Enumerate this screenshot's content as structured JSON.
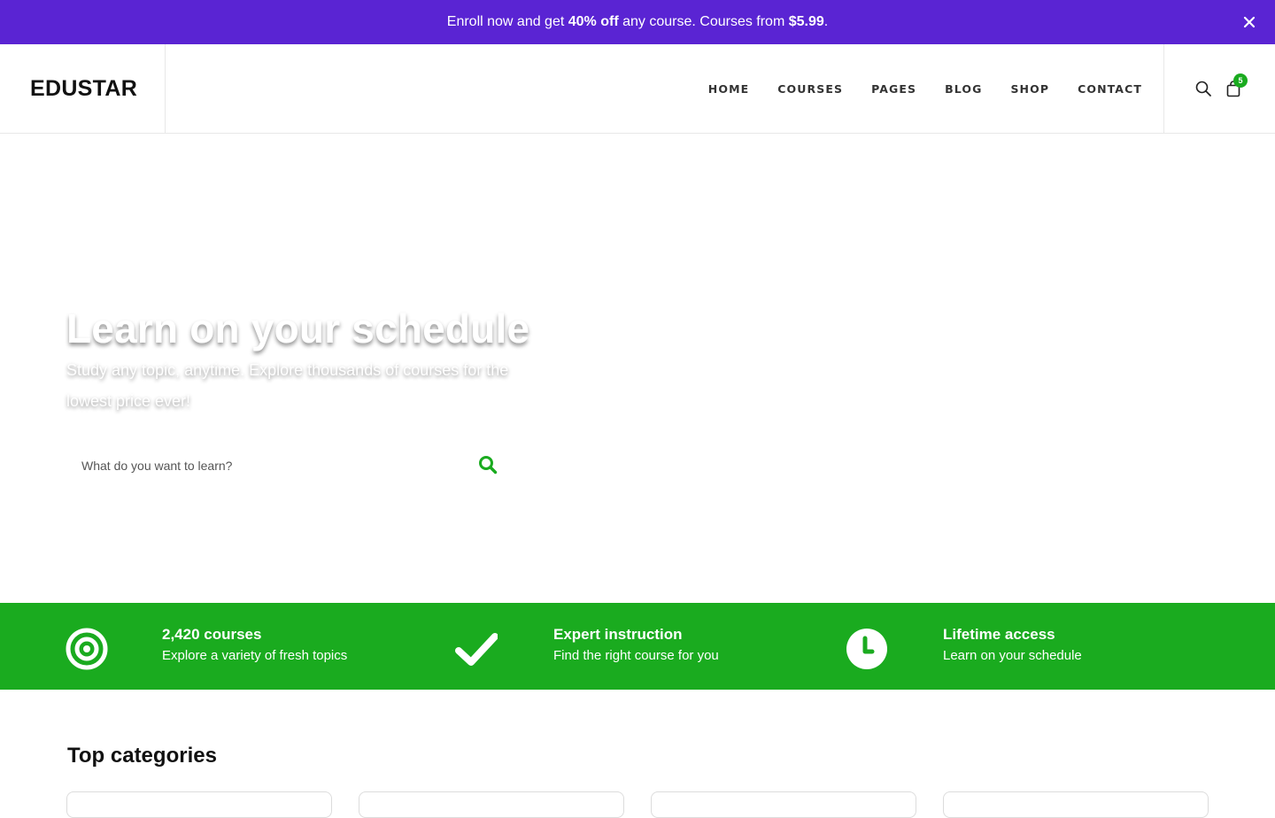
{
  "announcement": {
    "prefix": "Enroll now and get ",
    "highlight_discount": "40% off",
    "middle": " any course. Courses from ",
    "highlight_price": "$5.99",
    "suffix": "."
  },
  "header": {
    "logo": "EDUSTAR",
    "nav": [
      "HOME",
      "COURSES",
      "PAGES",
      "BLOG",
      "SHOP",
      "CONTACT"
    ],
    "cart_count": "5"
  },
  "hero": {
    "title": "Learn on your schedule",
    "subtitle": "Study any topic, anytime. Explore thousands of courses for the lowest price ever!",
    "search_placeholder": "What do you want to learn?"
  },
  "features": [
    {
      "icon": "target-icon",
      "title": "2,420 courses",
      "desc": "Explore a variety of fresh topics"
    },
    {
      "icon": "check-icon",
      "title": "Expert instruction",
      "desc": "Find the right course for you"
    },
    {
      "icon": "clock-icon",
      "title": "Lifetime access",
      "desc": "Learn on your schedule"
    }
  ],
  "categories": {
    "heading": "Top categories"
  },
  "colors": {
    "announcement_bg": "#5a24d3",
    "accent_green": "#1aab1f",
    "text_dark": "#111111"
  }
}
